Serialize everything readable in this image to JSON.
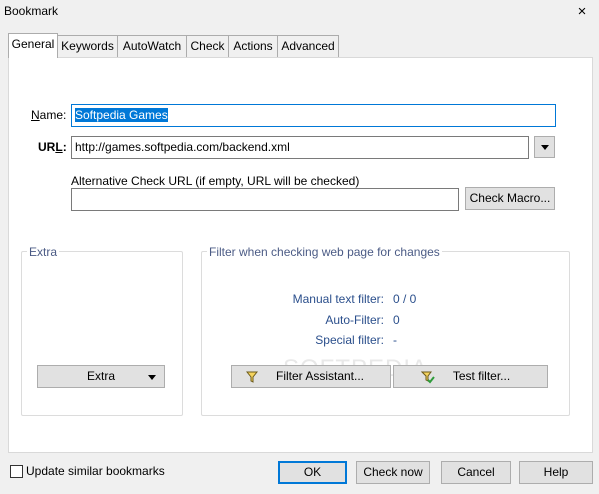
{
  "window": {
    "title": "Bookmark",
    "close_icon": "×"
  },
  "tabs": [
    "General",
    "Keywords",
    "AutoWatch",
    "Check",
    "Actions",
    "Advanced"
  ],
  "general": {
    "name_label": "Name:",
    "name_value": "Softpedia Games",
    "url_label": "URL:",
    "url_value": "http://games.softpedia.com/backend.xml",
    "alt_url_label": "Alternative Check URL (if empty, URL will be checked)",
    "alt_url_value": "",
    "check_macro_button": "Check Macro..."
  },
  "extra": {
    "title": "Extra",
    "button": "Extra"
  },
  "filter": {
    "title": "Filter when checking web page for changes",
    "manual_label": "Manual text filter:",
    "manual_value": "0 / 0",
    "auto_label": "Auto-Filter:",
    "auto_value": "0",
    "special_label": "Special filter:",
    "special_value": "-",
    "assistant_button": "Filter Assistant...",
    "test_button": "Test filter..."
  },
  "watermark": "SOFTPEDIA",
  "footer": {
    "update_similar_label": "Update similar bookmarks",
    "update_similar_checked": false,
    "ok_button": "OK",
    "check_now_button": "Check now",
    "cancel_button": "Cancel",
    "help_button": "Help"
  },
  "colors": {
    "accent": "#0078d7",
    "group_title": "#4b5b85",
    "filter_text": "#2b4f8c"
  }
}
